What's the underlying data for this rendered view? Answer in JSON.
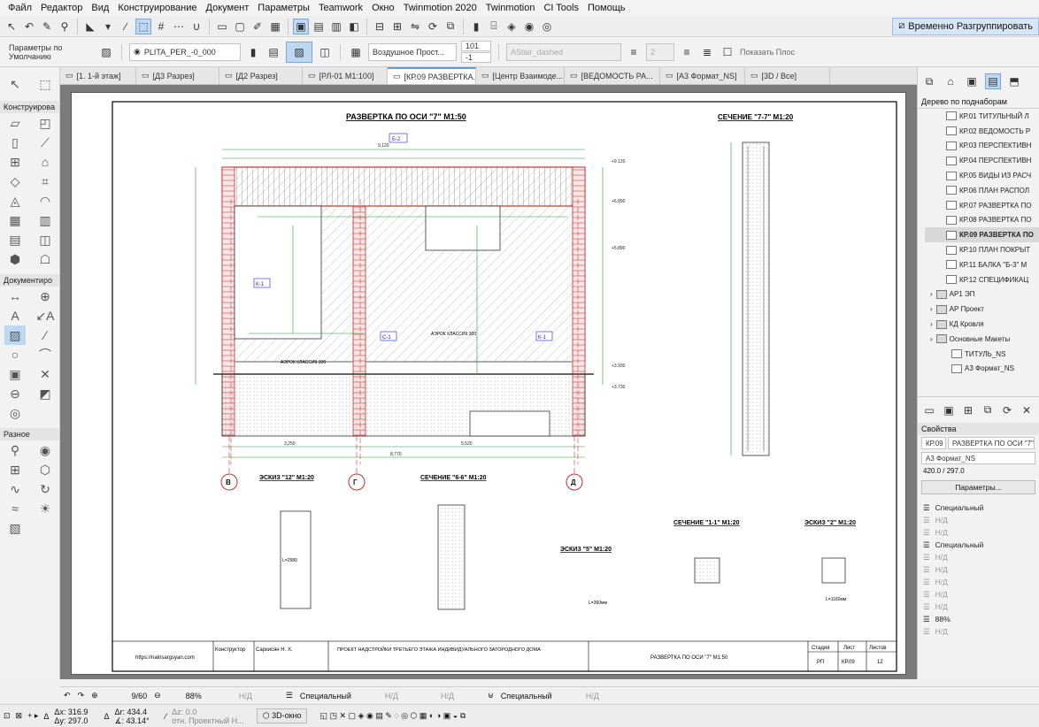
{
  "menu": [
    "Файл",
    "Редактор",
    "Вид",
    "Конструирование",
    "Документ",
    "Параметры",
    "Teamwork",
    "Окно",
    "Twinmotion 2020",
    "Twinmotion",
    "CI Tools",
    "Помощь"
  ],
  "toolbar": {
    "regroup_label": "Временно Разгруппировать"
  },
  "infobox": {
    "preset": "Параметры по Умолчанию",
    "layer": "PLITA_PER_-0_000",
    "fill": "Воздушное Прост...",
    "pen1": "101",
    "pen2": "-1",
    "linetype": "AStair_dashed",
    "num": "2",
    "show_label": "Показать Плос"
  },
  "tabs": [
    {
      "label": "[1. 1-й этаж]",
      "active": false
    },
    {
      "label": "[Д3 Разрез]",
      "active": false
    },
    {
      "label": "[Д2 Разрез]",
      "active": false
    },
    {
      "label": "[РЛ-01 М1:100]",
      "active": false
    },
    {
      "label": "[КР.09 РАЗВЕРТКА...",
      "active": true
    },
    {
      "label": "[Центр Взаимоде...",
      "active": false
    },
    {
      "label": "[ВЕДОМОСТЬ РА...",
      "active": false
    },
    {
      "label": "[А3 Формат_NS]",
      "active": false
    },
    {
      "label": "[3D / Все]",
      "active": false
    }
  ],
  "toolbox": {
    "sections": [
      "Конструирова",
      "Документиро",
      "Разное"
    ]
  },
  "navigator": {
    "title": "Дерево по поднаборам",
    "items": [
      {
        "label": "КР.01 ТИТУЛЬНЫЙ Л",
        "selected": false,
        "kind": "sheet"
      },
      {
        "label": "КР.02 ВЕДОМОСТЬ Р",
        "selected": false,
        "kind": "sheet"
      },
      {
        "label": "КР.03 ПЕРСПЕКТИВН",
        "selected": false,
        "kind": "sheet"
      },
      {
        "label": "КР.04 ПЕРСПЕКТИВН",
        "selected": false,
        "kind": "sheet"
      },
      {
        "label": "КР.05 ВИДЫ ИЗ РАСЧ",
        "selected": false,
        "kind": "sheet"
      },
      {
        "label": "КР.06 ПЛАН РАСПОЛ",
        "selected": false,
        "kind": "sheet"
      },
      {
        "label": "КР.07 РАЗВЕРТКА ПО",
        "selected": false,
        "kind": "sheet"
      },
      {
        "label": "КР.08 РАЗВЕРТКА ПО",
        "selected": false,
        "kind": "sheet"
      },
      {
        "label": "КР.09 РАЗВЕРТКА ПО",
        "selected": true,
        "kind": "sheet"
      },
      {
        "label": "КР.10 ПЛАН ПОКРЫТ",
        "selected": false,
        "kind": "sheet"
      },
      {
        "label": "КР.11 БАЛКА \"Б-3\" М",
        "selected": false,
        "kind": "sheet"
      },
      {
        "label": "КР.12 СПЕЦИФИКАЦ",
        "selected": false,
        "kind": "sheet"
      },
      {
        "label": "АР1 ЭП",
        "selected": false,
        "kind": "folder"
      },
      {
        "label": "АР Проект",
        "selected": false,
        "kind": "folder"
      },
      {
        "label": "КД Кровля",
        "selected": false,
        "kind": "folder"
      },
      {
        "label": "Основные Макеты",
        "selected": false,
        "kind": "folder"
      },
      {
        "label": "ТИТУЛЬ_NS",
        "selected": false,
        "kind": "sheet"
      },
      {
        "label": "А3 Формат_NS",
        "selected": false,
        "kind": "sheet"
      }
    ]
  },
  "properties": {
    "title": "Свойства",
    "id": "КР.09",
    "name": "РАЗВЕРТКА ПО ОСИ \"7\"",
    "master": "А3 Формат_NS",
    "size": "420.0 / 297.0",
    "settings_button": "Параметры...",
    "rows": [
      "Специальный",
      "Н/Д",
      "Н/Д",
      "Специальный",
      "Н/Д",
      "Н/Д",
      "Н/Д",
      "Н/Д",
      "Н/Д",
      "88%",
      "Н/Д"
    ]
  },
  "statusbar": {
    "page": "9/60",
    "zoom": "88%",
    "na1": "Н/Д",
    "special1": "Специальный",
    "na2": "Н/Д",
    "na3": "Н/Д",
    "special2": "Специальный",
    "na4": "Н/Д"
  },
  "bottombar": {
    "dx": "316.9",
    "dy": "297.0",
    "a": "434.4",
    "angle": "43.14°",
    "dz": "0.0",
    "ref": "отн. Проектный Н...",
    "view3d": "3D-окно"
  },
  "drawing": {
    "main_title": "РАЗВЕРТКА ПО ОСИ \"7\"   М1:50",
    "section77": "СЕЧЕНИЕ \"7-7\" М1:20",
    "sketch12": "ЭСКИЗ \"12\" М1:20",
    "section66": "СЕЧЕНИЕ \"6-6\" М1:20",
    "sketch5": "ЭСКИЗ \"5\" М1:20",
    "section11": "СЕЧЕНИЕ \"1-1\" М1:20",
    "sketch2": "ЭСКИЗ \"2\" М1:20",
    "axes": [
      "В",
      "Г",
      "Д"
    ],
    "label_b2": "Б-2",
    "label_k1": "К-1",
    "label_c1": "С-1",
    "aerok": "АЭРОК КЛАССИК 300",
    "dim_total": "8,770",
    "dim_a": "3,250",
    "dim_b": "5,520",
    "dim_top": "9,120",
    "level1": "+9.120",
    "level2": "+6.890",
    "level3": "+5.890",
    "level4": "+3.930",
    "level5": "+3.730",
    "sk12_len": "L=2580",
    "sk5_len": "L=360мм",
    "sk2_len": "L=1160мм",
    "stamp": {
      "site": "https://nairisargsyan.com",
      "role": "Конструктор",
      "person": "Саркисян Н. Х.",
      "project": "ПРОЕКТ НАДСТРОЙКИ ТРЕТЬЕГО ЭТАЖА ИНДИВИДУАЛЬНОГО ЗАГОРОДНОГО ДОМА",
      "sheet_name": "РАЗВЕРТКА ПО ОСИ \"7\"   М1:50",
      "h_stage": "Стадия",
      "h_sheet": "Лист",
      "h_sheets": "Листов",
      "stage": "РП",
      "sheet": "КР.09",
      "sheets": "12"
    }
  }
}
